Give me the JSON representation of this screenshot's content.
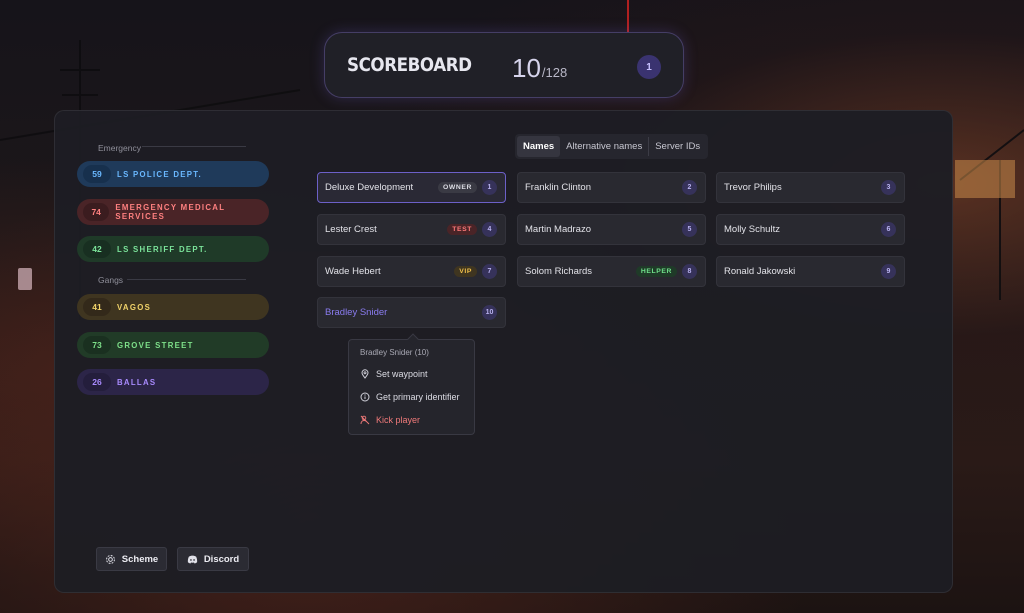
{
  "header": {
    "title": "SCOREBOARD",
    "current": "10",
    "max": "/128",
    "badge": "1"
  },
  "sections": {
    "emergency": "Emergency",
    "gangs": "Gangs"
  },
  "jobs": [
    {
      "count": "59",
      "label": "LS POLICE DEPT.",
      "color": "#6ab8ff",
      "bg": "#1f3a5a",
      "numbg": "#17304d"
    },
    {
      "count": "74",
      "label": "EMERGENCY MEDICAL SERVICES",
      "color": "#ff8080",
      "bg": "#4a2427",
      "numbg": "#3b1c1f"
    },
    {
      "count": "42",
      "label": "LS SHERIFF DEPT.",
      "color": "#7be39a",
      "bg": "#1f3a28",
      "numbg": "#182f21"
    },
    {
      "count": "41",
      "label": "VAGOS",
      "color": "#f2d46a",
      "bg": "#3f3520",
      "numbg": "#33291a"
    },
    {
      "count": "73",
      "label": "GROVE STREET",
      "color": "#7ee08a",
      "bg": "#213b27",
      "numbg": "#1a3020"
    },
    {
      "count": "26",
      "label": "BALLAS",
      "color": "#a98bff",
      "bg": "#2c2548",
      "numbg": "#241e3c"
    }
  ],
  "tabs": [
    "Names",
    "Alternative names",
    "Server IDs"
  ],
  "players": [
    {
      "name": "Deluxe Development",
      "tag": "OWNER",
      "tagColor": "#dcdce4",
      "tagBg": "#3a3a44",
      "id": "1"
    },
    {
      "name": "Franklin Clinton",
      "tag": "",
      "id": "2"
    },
    {
      "name": "Trevor Philips",
      "tag": "",
      "id": "3"
    },
    {
      "name": "Lester Crest",
      "tag": "TEST",
      "tagColor": "#ff7a7a",
      "tagBg": "#4a2427",
      "id": "4"
    },
    {
      "name": "Martin Madrazo",
      "tag": "",
      "id": "5"
    },
    {
      "name": "Molly Schultz",
      "tag": "",
      "id": "6"
    },
    {
      "name": "Wade Hebert",
      "tag": "VIP",
      "tagColor": "#f2c14a",
      "tagBg": "#3f3520",
      "id": "7"
    },
    {
      "name": "Solom Richards",
      "tag": "HELPER",
      "tagColor": "#6fe08a",
      "tagBg": "#1f3a28",
      "id": "8"
    },
    {
      "name": "Ronald Jakowski",
      "tag": "",
      "id": "9"
    },
    {
      "name": "Bradley Snider",
      "tag": "",
      "id": "10"
    }
  ],
  "context_menu": {
    "title": "Bradley Snider (10)",
    "items": [
      {
        "label": "Set waypoint",
        "icon": "map-pin-icon"
      },
      {
        "label": "Get primary identifier",
        "icon": "info-icon"
      },
      {
        "label": "Kick player",
        "icon": "user-x-icon"
      }
    ]
  },
  "buttons": {
    "scheme": "Scheme",
    "discord": "Discord"
  }
}
